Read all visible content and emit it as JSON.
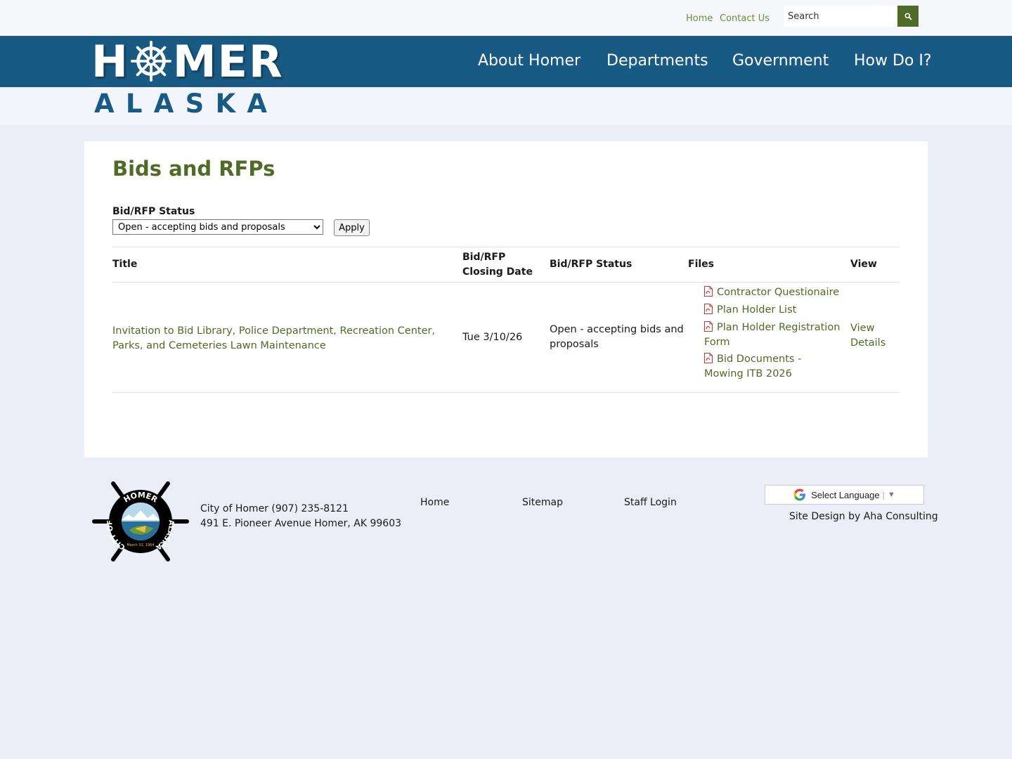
{
  "topbar": {
    "links": [
      {
        "label": "Home"
      },
      {
        "label": "Contact Us"
      }
    ],
    "search_placeholder": "Search"
  },
  "logo": {
    "homer_left": "H",
    "homer_right": "MER",
    "alaska_letters": [
      "A",
      "L",
      "A",
      "S",
      "K",
      "A"
    ]
  },
  "nav": {
    "items": [
      {
        "label": "About Homer"
      },
      {
        "label": "Departments"
      },
      {
        "label": "Government"
      },
      {
        "label": "How Do I?"
      }
    ]
  },
  "main": {
    "title": "Bids and RFPs",
    "filter": {
      "label": "Bid/RFP Status",
      "selected": "Open - accepting bids and proposals",
      "apply_label": "Apply"
    },
    "table": {
      "headers": {
        "title": "Title",
        "closing_date": "Bid/RFP Closing Date",
        "status": "Bid/RFP Status",
        "files": "Files",
        "view": "View"
      },
      "rows": [
        {
          "title": "Invitation to Bid Library, Police Department, Recreation Center, Parks, and Cemeteries Lawn Maintenance",
          "closing_date": "Tue 3/10/26",
          "status": "Open - accepting bids and proposals",
          "files": [
            {
              "label": "Contractor Questionaire"
            },
            {
              "label": "Plan Holder List"
            },
            {
              "label": "Plan Holder Registration Form"
            },
            {
              "label": "Bid Documents - Mowing ITB 2026"
            }
          ],
          "view_label": "View Details"
        }
      ]
    }
  },
  "footer": {
    "seal": {
      "top_text": "HOMER",
      "left_text": "CITY OF",
      "right_text": "ALASKA",
      "date_text": "March 31, 1964"
    },
    "contact_line1": "City of Homer (907) 235-8121",
    "contact_line2": "491 E. Pioneer Avenue Homer, AK 99603",
    "links": [
      {
        "label": "Home"
      },
      {
        "label": "Sitemap"
      },
      {
        "label": "Staff Login"
      }
    ],
    "language_label": "Select Language",
    "language_arrow": "▼",
    "credit": "Site Design by Aha Consulting"
  },
  "colors": {
    "brand_blue": "#195a85",
    "accent_green": "#4f6b25",
    "page_bg": "#ebeef6"
  }
}
